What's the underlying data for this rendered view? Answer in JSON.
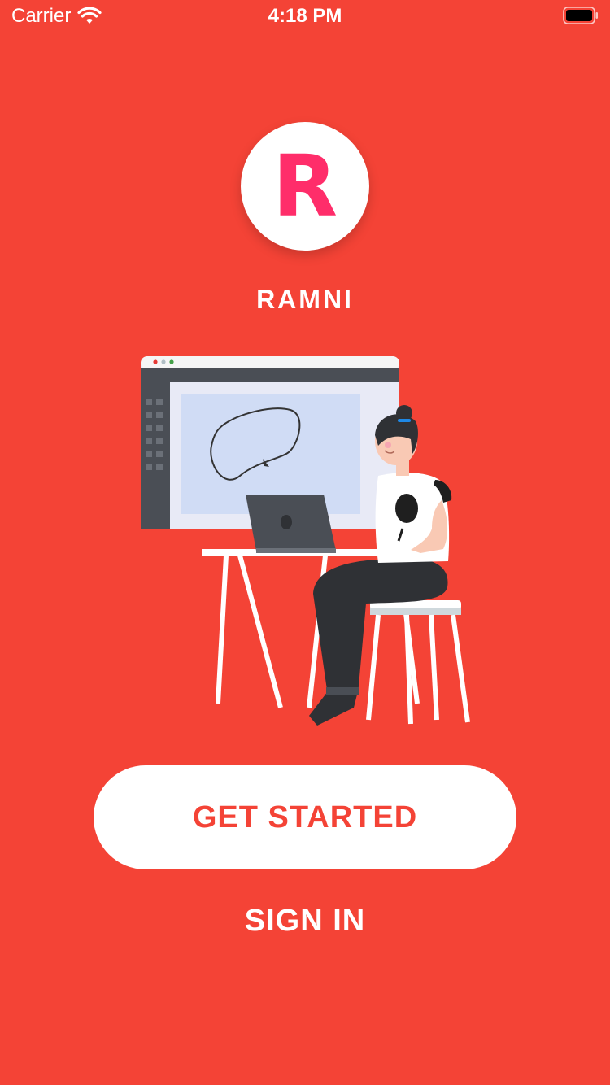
{
  "status_bar": {
    "carrier": "Carrier",
    "time": "4:18 PM",
    "icons": [
      "wifi-icon",
      "battery-icon"
    ]
  },
  "logo": {
    "letter": "R"
  },
  "brand": {
    "name": "RAMNI"
  },
  "actions": {
    "get_started_label": "GET STARTED",
    "sign_in_label": "SIGN IN"
  },
  "colors": {
    "background": "#F44336",
    "logo_letter": "#FF2D6A",
    "button_bg": "#FFFFFF",
    "button_text": "#F44336"
  }
}
